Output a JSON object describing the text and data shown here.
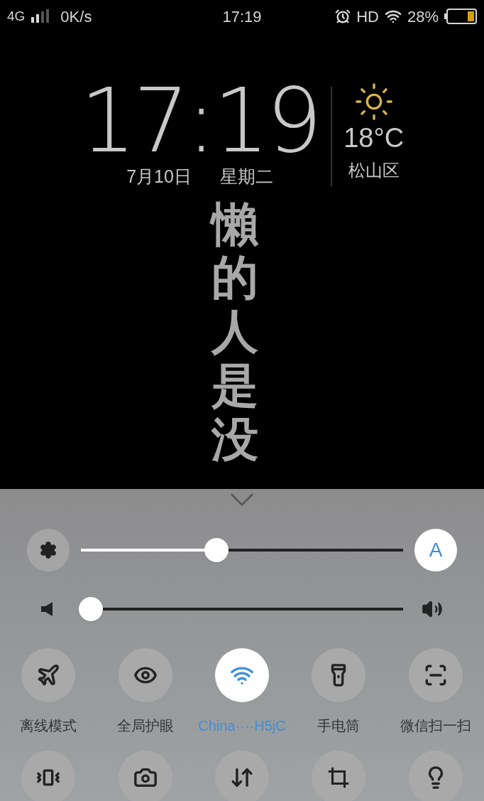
{
  "status_bar": {
    "network": "4G",
    "speed": "0K/s",
    "time": "17:19",
    "hd": "HD",
    "battery": "28%"
  },
  "lock_clock": {
    "time": "17:19",
    "date": "7月10日",
    "weekday": "星期二",
    "temperature": "18°C",
    "location": "松山区"
  },
  "wallpaper_text": "懶的人是没",
  "controls": {
    "brightness": {
      "level": 0.42,
      "auto": {
        "label": "A",
        "on": true
      }
    },
    "volume": {
      "level": 0
    }
  },
  "tiles": [
    {
      "kind": "airplane",
      "label": "离线模式",
      "on": false
    },
    {
      "kind": "eye",
      "label": "全局护眼",
      "on": false
    },
    {
      "kind": "wifi",
      "label": "China····H5jC",
      "on": true
    },
    {
      "kind": "flashlight",
      "label": "手电筒",
      "on": false
    },
    {
      "kind": "scan",
      "label": "微信扫一扫",
      "on": false
    },
    {
      "kind": "vibrate",
      "on": false
    },
    {
      "kind": "camera",
      "on": false
    },
    {
      "kind": "data",
      "on": false
    },
    {
      "kind": "screenshot",
      "on": false
    },
    {
      "kind": "bulb",
      "on": false
    }
  ]
}
